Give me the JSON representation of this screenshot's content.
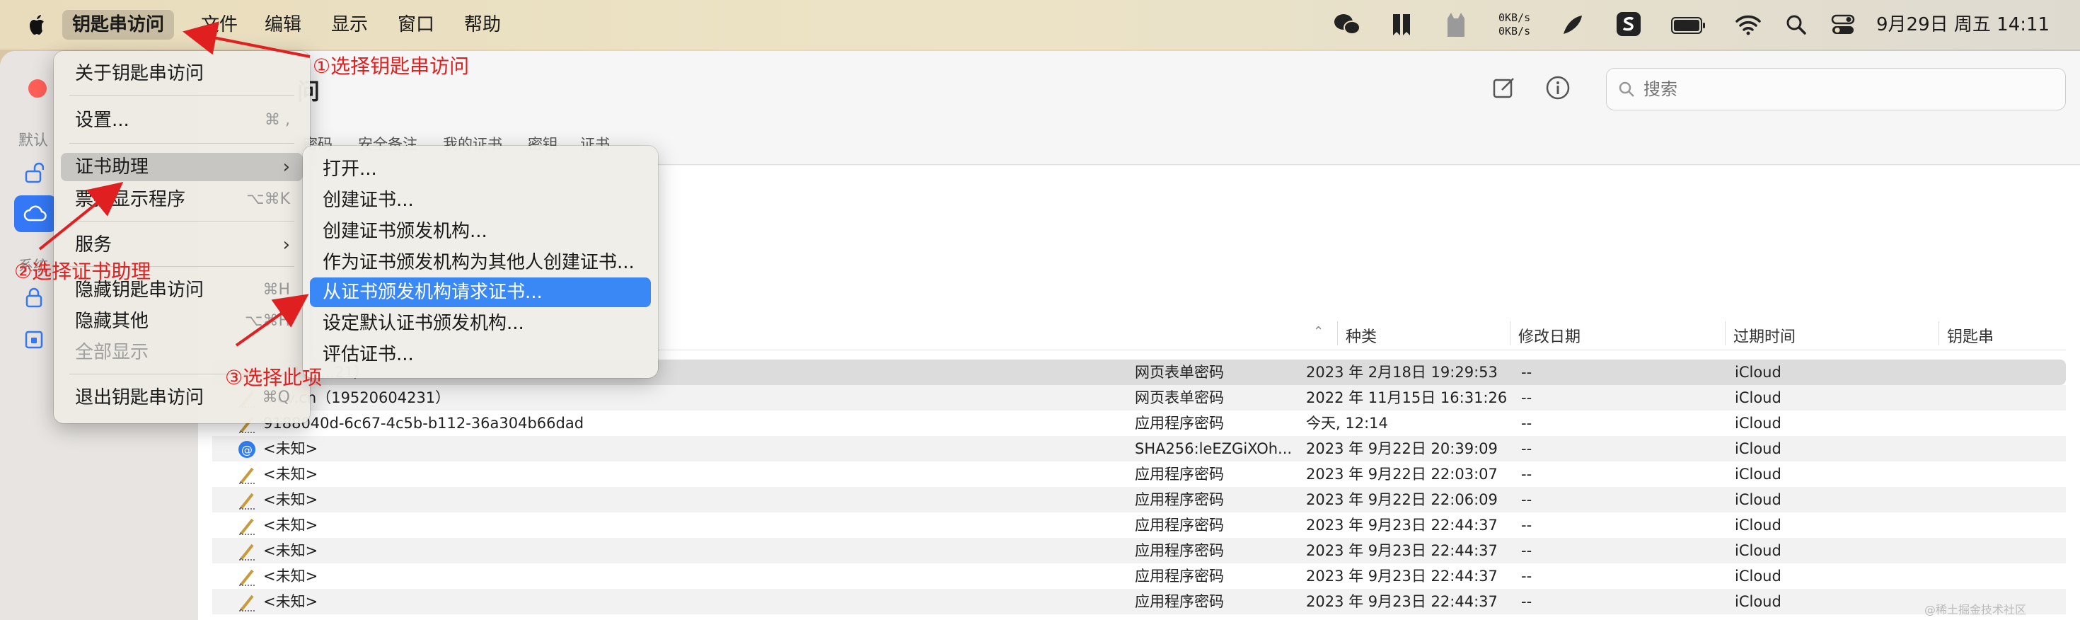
{
  "menubar": {
    "app_name": "钥匙串访问",
    "items": [
      "文件",
      "编辑",
      "显示",
      "窗口",
      "帮助"
    ],
    "net_up": "0KB/s",
    "net_down": "0KB/s",
    "clock": "9月29日 周五  14:11"
  },
  "app_menu": {
    "items": [
      {
        "label": "关于钥匙串访问",
        "shortcut": ""
      },
      {
        "label": "设置...",
        "shortcut": "⌘ ,"
      },
      {
        "label": "证书助理",
        "shortcut": ""
      },
      {
        "label": "票据显示程序",
        "shortcut": "⌥⌘K"
      },
      {
        "label": "服务",
        "shortcut": ""
      },
      {
        "label": "隐藏钥匙串访问",
        "shortcut": "⌘H"
      },
      {
        "label": "隐藏其他",
        "shortcut": "⌥⌘H"
      },
      {
        "label": "全部显示",
        "shortcut": ""
      },
      {
        "label": "退出钥匙串访问",
        "shortcut": "⌘Q"
      }
    ]
  },
  "submenu": {
    "items": [
      "打开...",
      "创建证书...",
      "创建证书颁发机构...",
      "作为证书颁发机构为其他人创建证书...",
      "从证书颁发机构请求证书...",
      "设定默认证书颁发机构...",
      "评估证书..."
    ]
  },
  "window": {
    "title_partial": "问",
    "sidebar_caption": "默认",
    "sidebar_caption2": "系统",
    "search_placeholder": "搜索",
    "tabs": [
      "密码",
      "安全备注",
      "我的证书",
      "密钥",
      "证书"
    ]
  },
  "table": {
    "columns": [
      "种类",
      "修改日期",
      "过期时间",
      "钥匙串"
    ],
    "rows": [
      {
        "name": "...（1...     ...21）",
        "kind": "网页表单密码",
        "modified": "2023 年 2月18日 19:29:53",
        "expires": "--",
        "keychain": "iCloud"
      },
      {
        "name": "...ov.cn（19520604231）",
        "kind": "网页表单密码",
        "modified": "2022 年 11月15日 16:31:26",
        "expires": "--",
        "keychain": "iCloud"
      },
      {
        "name": "9188040d-6c67-4c5b-b112-36a304b66dad",
        "kind": "应用程序密码",
        "modified": "今天, 12:14",
        "expires": "--",
        "keychain": "iCloud"
      },
      {
        "name": "<未知>",
        "kind": "SHA256:leEZGiXOh...",
        "modified": "2023 年 9月22日 20:39:09",
        "expires": "--",
        "keychain": "iCloud"
      },
      {
        "name": "<未知>",
        "kind": "应用程序密码",
        "modified": "2023 年 9月22日 22:03:07",
        "expires": "--",
        "keychain": "iCloud"
      },
      {
        "name": "<未知>",
        "kind": "应用程序密码",
        "modified": "2023 年 9月22日 22:06:09",
        "expires": "--",
        "keychain": "iCloud"
      },
      {
        "name": "<未知>",
        "kind": "应用程序密码",
        "modified": "2023 年 9月23日 22:44:37",
        "expires": "--",
        "keychain": "iCloud"
      },
      {
        "name": "<未知>",
        "kind": "应用程序密码",
        "modified": "2023 年 9月23日 22:44:37",
        "expires": "--",
        "keychain": "iCloud"
      },
      {
        "name": "<未知>",
        "kind": "应用程序密码",
        "modified": "2023 年 9月23日 22:44:37",
        "expires": "--",
        "keychain": "iCloud"
      },
      {
        "name": "<未知>",
        "kind": "应用程序密码",
        "modified": "2023 年 9月23日 22:44:37",
        "expires": "--",
        "keychain": "iCloud"
      }
    ]
  },
  "annotations": {
    "step1": "①选择钥匙串访问",
    "step2": "②选择证书助理",
    "step3": "③选择此项",
    "color": "#e02020"
  },
  "watermark": "@稀土掘金技术社区"
}
